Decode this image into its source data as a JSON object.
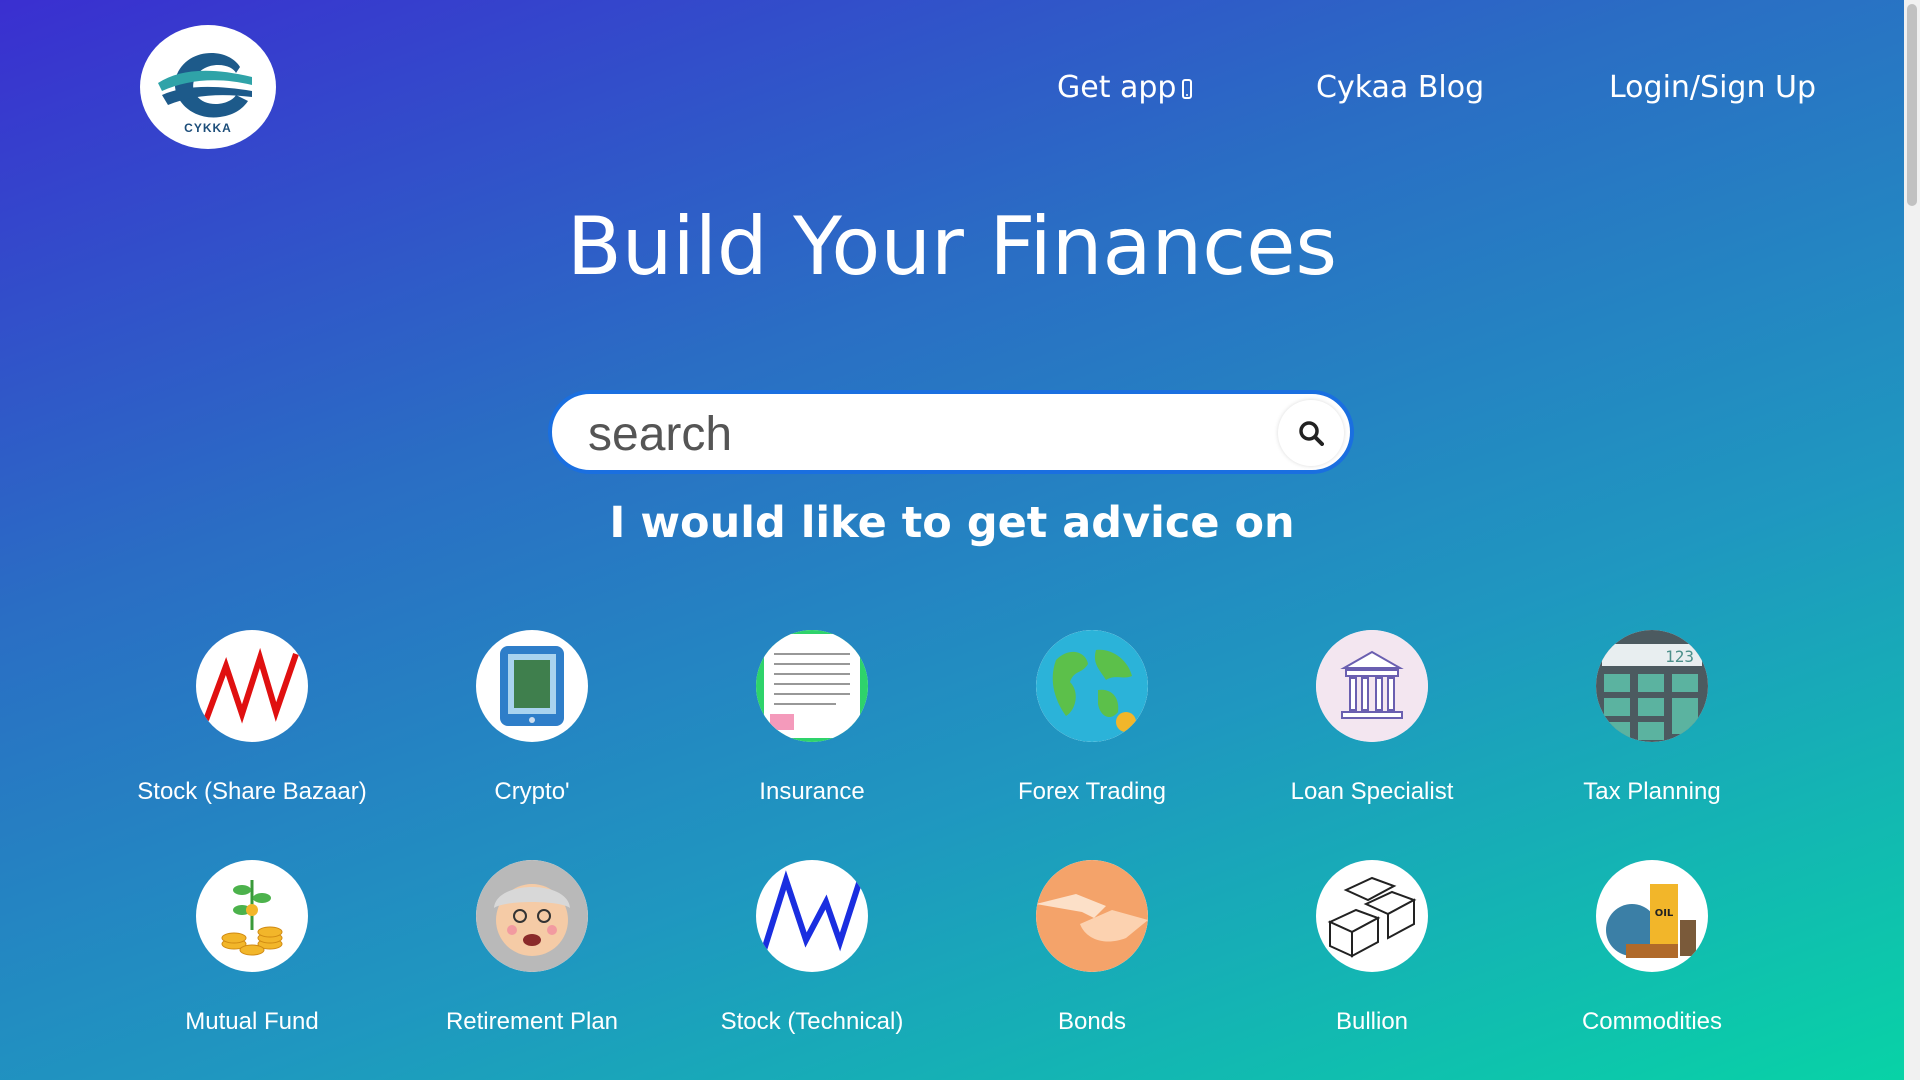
{
  "header": {
    "logo_text": "CYKKA",
    "nav": {
      "get_app": "Get app",
      "blog": "Cykaa Blog",
      "login": "Login/Sign Up"
    }
  },
  "hero": {
    "title": "Build Your Finances",
    "search_placeholder": "search",
    "subtitle": "I would like to get advice on"
  },
  "categories": [
    {
      "label": "Stock (Share Bazaar)",
      "icon": "stock-chart-icon"
    },
    {
      "label": "Crypto'",
      "icon": "crypto-tablet-icon"
    },
    {
      "label": "Insurance",
      "icon": "insurance-document-icon"
    },
    {
      "label": "Forex Trading",
      "icon": "globe-icon"
    },
    {
      "label": "Loan Specialist",
      "icon": "bank-building-icon"
    },
    {
      "label": "Tax Planning",
      "icon": "calculator-icon"
    },
    {
      "label": "Mutual Fund",
      "icon": "money-plant-icon"
    },
    {
      "label": "Retirement Plan",
      "icon": "elderly-man-icon"
    },
    {
      "label": "Stock (Technical)",
      "icon": "technical-chart-icon"
    },
    {
      "label": "Bonds",
      "icon": "handshake-icon"
    },
    {
      "label": "Bullion",
      "icon": "gold-bars-icon"
    },
    {
      "label": "Commodities",
      "icon": "oil-commodities-icon"
    }
  ],
  "colors": {
    "gradient_start": "#3a2fd0",
    "gradient_end": "#08d3a6",
    "search_border": "#1a6fe0"
  }
}
